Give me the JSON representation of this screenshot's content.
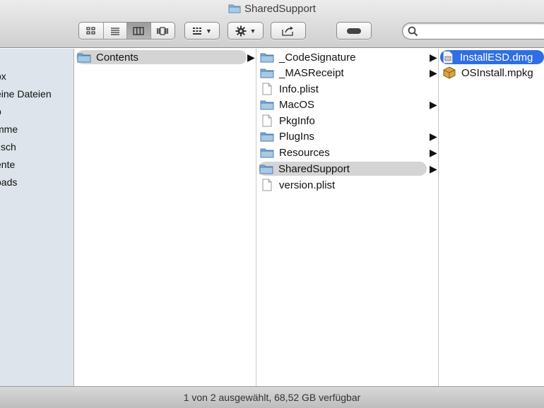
{
  "window": {
    "title": "SharedSupport"
  },
  "toolbar": {
    "view_buttons": [
      "icon-view-icon",
      "list-view-icon",
      "column-view-icon",
      "coverflow-view-icon"
    ],
    "active_view": "column-view-icon",
    "arrange_icon": "arrange-icon",
    "action_icon": "gear-icon",
    "share_icon": "share-icon",
    "toggle_icon": "toolbar-toggle-icon",
    "search_placeholder": ""
  },
  "sidebar": {
    "items": [
      {
        "label": "ox"
      },
      {
        "label": "eine Dateien"
      },
      {
        "label": "p"
      },
      {
        "label": "mme"
      },
      {
        "label": "tisch"
      },
      {
        "label": "ente"
      },
      {
        "label": "oads"
      }
    ]
  },
  "columns": [
    {
      "items": [
        {
          "label": "Contents",
          "type": "folder",
          "has_children": true,
          "selected": "grey"
        }
      ]
    },
    {
      "items": [
        {
          "label": "_CodeSignature",
          "type": "folder",
          "has_children": true
        },
        {
          "label": "_MASReceipt",
          "type": "folder",
          "has_children": true
        },
        {
          "label": "Info.plist",
          "type": "file",
          "has_children": false
        },
        {
          "label": "MacOS",
          "type": "folder",
          "has_children": true
        },
        {
          "label": "PkgInfo",
          "type": "file",
          "has_children": false
        },
        {
          "label": "PlugIns",
          "type": "folder",
          "has_children": true
        },
        {
          "label": "Resources",
          "type": "folder",
          "has_children": true
        },
        {
          "label": "SharedSupport",
          "type": "folder",
          "has_children": true,
          "selected": "grey"
        },
        {
          "label": "version.plist",
          "type": "file",
          "has_children": false
        }
      ]
    },
    {
      "items": [
        {
          "label": "InstallESD.dmg",
          "type": "dmg",
          "selected": "blue"
        },
        {
          "label": "OSInstall.mpkg",
          "type": "package"
        }
      ]
    }
  ],
  "status": {
    "text": "1 von 2 ausgewählt, 68,52 GB verfügbar"
  },
  "colors": {
    "selection_blue": "#2f6fe3",
    "selection_grey": "#d4d4d4",
    "sidebar": "#dde4eb",
    "folder": "#8fb8dc"
  }
}
